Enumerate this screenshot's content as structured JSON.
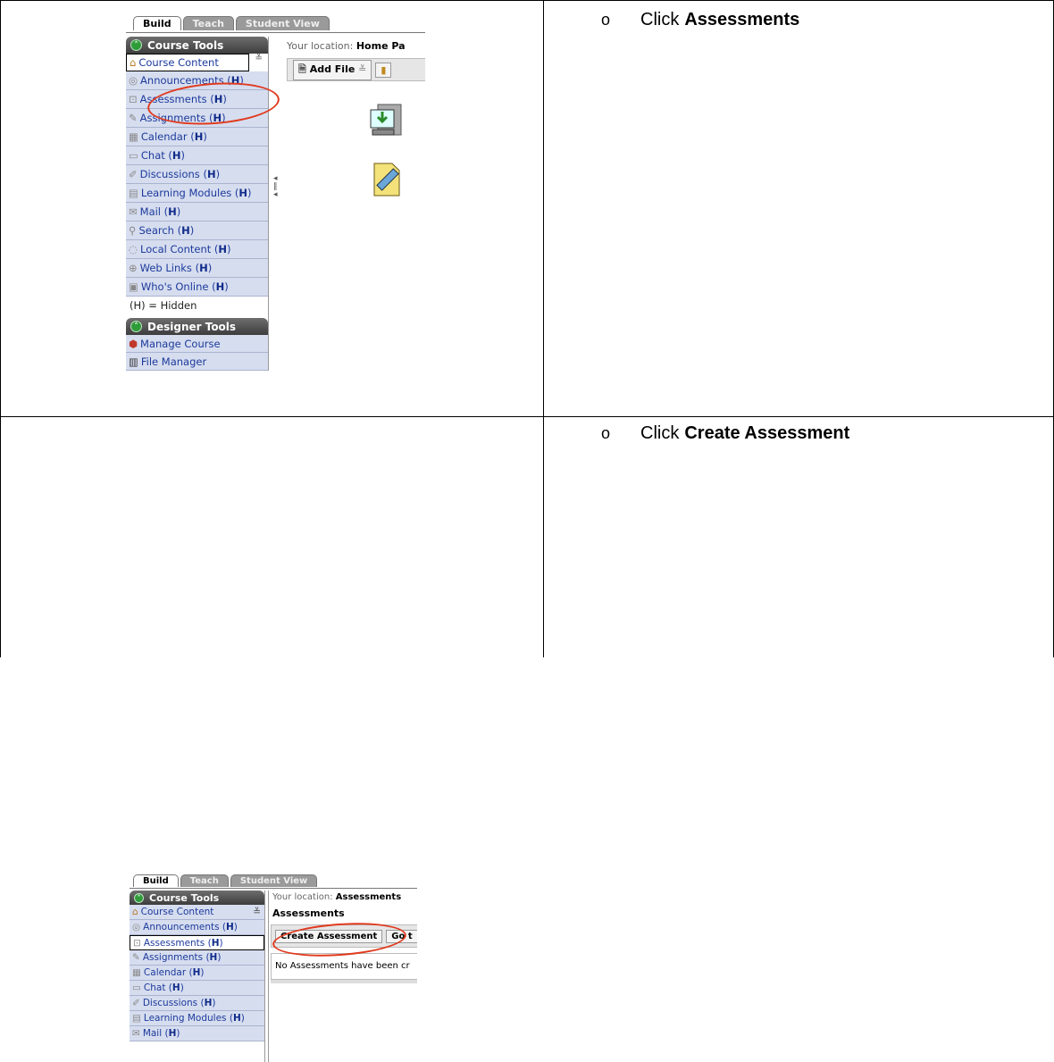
{
  "steps": [
    {
      "instruction_prefix": "Click",
      "instruction_target": "Assessments",
      "bullet": "o"
    },
    {
      "instruction_prefix": "Click",
      "instruction_target": "Create Assessment",
      "bullet": "o"
    }
  ],
  "shot1": {
    "tabs": [
      "Build",
      "Teach",
      "Student View"
    ],
    "course_tools_header": "Course Tools",
    "course_content": "Course Content",
    "items": [
      {
        "label": "Announcements",
        "flag": "H"
      },
      {
        "label": "Assessments",
        "flag": "H"
      },
      {
        "label": "Assignments",
        "flag": "H"
      },
      {
        "label": "Calendar",
        "flag": "H"
      },
      {
        "label": "Chat",
        "flag": "H"
      },
      {
        "label": "Discussions",
        "flag": "H"
      },
      {
        "label": "Learning Modules",
        "flag": "H"
      },
      {
        "label": "Mail",
        "flag": "H"
      },
      {
        "label": "Search",
        "flag": "H"
      },
      {
        "label": "Local Content",
        "flag": "H"
      },
      {
        "label": "Web Links",
        "flag": "H"
      },
      {
        "label": "Who's Online",
        "flag": "H"
      }
    ],
    "hidden_note": "(H) = Hidden",
    "designer_tools_header": "Designer Tools",
    "designer_items": [
      "Manage Course",
      "File Manager"
    ],
    "location_label": "Your location:",
    "location_value": "Home Pa",
    "add_file_label": "Add File"
  },
  "shot2": {
    "tabs": [
      "Build",
      "Teach",
      "Student View"
    ],
    "course_tools_header": "Course Tools",
    "course_content": "Course Content",
    "items": [
      {
        "label": "Announcements",
        "flag": "H"
      },
      {
        "label": "Assessments",
        "flag": "H"
      },
      {
        "label": "Assignments",
        "flag": "H"
      },
      {
        "label": "Calendar",
        "flag": "H"
      },
      {
        "label": "Chat",
        "flag": "H"
      },
      {
        "label": "Discussions",
        "flag": "H"
      },
      {
        "label": "Learning Modules",
        "flag": "H"
      },
      {
        "label": "Mail",
        "flag": "H"
      }
    ],
    "location_label": "Your location:",
    "location_value": "Assessments",
    "page_heading": "Assessments",
    "create_button": "Create Assessment",
    "go_button": "Go t",
    "empty_message": "No Assessments have been cr"
  },
  "colors": {
    "highlight": "#e03a1e",
    "sidebar_item_bg": "#d6ddef",
    "link_blue": "#1c3a9c"
  },
  "icons": [
    "home-icon",
    "chevron-down-icon",
    "megaphone-icon",
    "assessment-icon",
    "assignment-icon",
    "calendar-icon",
    "chat-icon",
    "pin-icon",
    "module-icon",
    "mail-icon",
    "search-icon",
    "local-content-icon",
    "web-links-icon",
    "whos-online-icon",
    "manage-course-icon",
    "file-manager-icon",
    "document-icon",
    "computer-download-icon",
    "ruler-document-icon"
  ]
}
